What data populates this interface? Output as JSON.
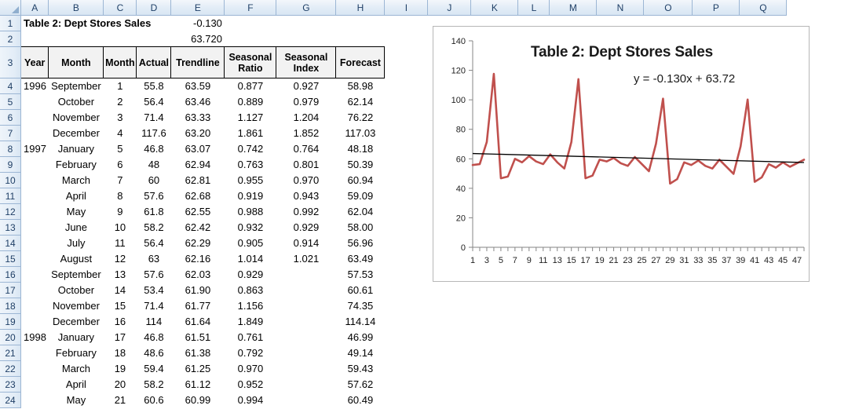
{
  "spreadsheet": {
    "column_headers": [
      "A",
      "B",
      "C",
      "D",
      "E",
      "F",
      "G",
      "H",
      "I",
      "J",
      "K",
      "L",
      "M",
      "N",
      "O",
      "P",
      "Q"
    ],
    "row_numbers": [
      "1",
      "2",
      "3",
      "4",
      "5",
      "6",
      "7",
      "8",
      "9",
      "10",
      "11",
      "12",
      "13",
      "14",
      "15",
      "16",
      "17",
      "18",
      "19",
      "20",
      "21",
      "22",
      "23",
      "24"
    ],
    "title_cell": "Table 2: Dept Stores Sales",
    "slope_cell": "-0.130",
    "intercept_cell": "63.720",
    "table_headers": [
      "Year",
      "Month",
      "Month",
      "Actual",
      "Trendline",
      "Seasonal Ratio",
      "Seasonal Index",
      "Forecast"
    ],
    "table_headers_lines": [
      [
        "Year"
      ],
      [
        "Month"
      ],
      [
        "Month"
      ],
      [
        "Actual"
      ],
      [
        "Trendline"
      ],
      [
        "Seasonal",
        "Ratio"
      ],
      [
        "Seasonal",
        "Index"
      ],
      [
        "Forecast"
      ]
    ],
    "rows": [
      {
        "row": "4",
        "year": "1996",
        "month_name": "September",
        "month_num": "1",
        "actual": "55.8",
        "trendline": "63.59",
        "seasonal_ratio": "0.877",
        "seasonal_index": "0.927",
        "forecast": "58.98"
      },
      {
        "row": "5",
        "year": "",
        "month_name": "October",
        "month_num": "2",
        "actual": "56.4",
        "trendline": "63.46",
        "seasonal_ratio": "0.889",
        "seasonal_index": "0.979",
        "forecast": "62.14"
      },
      {
        "row": "6",
        "year": "",
        "month_name": "November",
        "month_num": "3",
        "actual": "71.4",
        "trendline": "63.33",
        "seasonal_ratio": "1.127",
        "seasonal_index": "1.204",
        "forecast": "76.22"
      },
      {
        "row": "7",
        "year": "",
        "month_name": "December",
        "month_num": "4",
        "actual": "117.6",
        "trendline": "63.20",
        "seasonal_ratio": "1.861",
        "seasonal_index": "1.852",
        "forecast": "117.03"
      },
      {
        "row": "8",
        "year": "1997",
        "month_name": "January",
        "month_num": "5",
        "actual": "46.8",
        "trendline": "63.07",
        "seasonal_ratio": "0.742",
        "seasonal_index": "0.764",
        "forecast": "48.18"
      },
      {
        "row": "9",
        "year": "",
        "month_name": "February",
        "month_num": "6",
        "actual": "48",
        "trendline": "62.94",
        "seasonal_ratio": "0.763",
        "seasonal_index": "0.801",
        "forecast": "50.39"
      },
      {
        "row": "10",
        "year": "",
        "month_name": "March",
        "month_num": "7",
        "actual": "60",
        "trendline": "62.81",
        "seasonal_ratio": "0.955",
        "seasonal_index": "0.970",
        "forecast": "60.94"
      },
      {
        "row": "11",
        "year": "",
        "month_name": "April",
        "month_num": "8",
        "actual": "57.6",
        "trendline": "62.68",
        "seasonal_ratio": "0.919",
        "seasonal_index": "0.943",
        "forecast": "59.09"
      },
      {
        "row": "12",
        "year": "",
        "month_name": "May",
        "month_num": "9",
        "actual": "61.8",
        "trendline": "62.55",
        "seasonal_ratio": "0.988",
        "seasonal_index": "0.992",
        "forecast": "62.04"
      },
      {
        "row": "13",
        "year": "",
        "month_name": "June",
        "month_num": "10",
        "actual": "58.2",
        "trendline": "62.42",
        "seasonal_ratio": "0.932",
        "seasonal_index": "0.929",
        "forecast": "58.00"
      },
      {
        "row": "14",
        "year": "",
        "month_name": "July",
        "month_num": "11",
        "actual": "56.4",
        "trendline": "62.29",
        "seasonal_ratio": "0.905",
        "seasonal_index": "0.914",
        "forecast": "56.96"
      },
      {
        "row": "15",
        "year": "",
        "month_name": "August",
        "month_num": "12",
        "actual": "63",
        "trendline": "62.16",
        "seasonal_ratio": "1.014",
        "seasonal_index": "1.021",
        "forecast": "63.49"
      },
      {
        "row": "16",
        "year": "",
        "month_name": "September",
        "month_num": "13",
        "actual": "57.6",
        "trendline": "62.03",
        "seasonal_ratio": "0.929",
        "seasonal_index": "",
        "forecast": "57.53"
      },
      {
        "row": "17",
        "year": "",
        "month_name": "October",
        "month_num": "14",
        "actual": "53.4",
        "trendline": "61.90",
        "seasonal_ratio": "0.863",
        "seasonal_index": "",
        "forecast": "60.61"
      },
      {
        "row": "18",
        "year": "",
        "month_name": "November",
        "month_num": "15",
        "actual": "71.4",
        "trendline": "61.77",
        "seasonal_ratio": "1.156",
        "seasonal_index": "",
        "forecast": "74.35"
      },
      {
        "row": "19",
        "year": "",
        "month_name": "December",
        "month_num": "16",
        "actual": "114",
        "trendline": "61.64",
        "seasonal_ratio": "1.849",
        "seasonal_index": "",
        "forecast": "114.14"
      },
      {
        "row": "20",
        "year": "1998",
        "month_name": "January",
        "month_num": "17",
        "actual": "46.8",
        "trendline": "61.51",
        "seasonal_ratio": "0.761",
        "seasonal_index": "",
        "forecast": "46.99"
      },
      {
        "row": "21",
        "year": "",
        "month_name": "February",
        "month_num": "18",
        "actual": "48.6",
        "trendline": "61.38",
        "seasonal_ratio": "0.792",
        "seasonal_index": "",
        "forecast": "49.14"
      },
      {
        "row": "22",
        "year": "",
        "month_name": "March",
        "month_num": "19",
        "actual": "59.4",
        "trendline": "61.25",
        "seasonal_ratio": "0.970",
        "seasonal_index": "",
        "forecast": "59.43"
      },
      {
        "row": "23",
        "year": "",
        "month_name": "April",
        "month_num": "20",
        "actual": "58.2",
        "trendline": "61.12",
        "seasonal_ratio": "0.952",
        "seasonal_index": "",
        "forecast": "57.62"
      },
      {
        "row": "24",
        "year": "",
        "month_name": "May",
        "month_num": "21",
        "actual": "60.6",
        "trendline": "60.99",
        "seasonal_ratio": "0.994",
        "seasonal_index": "",
        "forecast": "60.49"
      }
    ]
  },
  "chart_data": {
    "type": "line",
    "title": "Table 2: Dept Stores Sales",
    "annotation": "y = -0.130x + 63.72",
    "xlabel": "",
    "ylabel": "",
    "ylim": [
      0,
      140
    ],
    "ytick_values": [
      0,
      20,
      40,
      60,
      80,
      100,
      120,
      140
    ],
    "xlim": [
      1,
      48
    ],
    "xtick_labels": [
      "1",
      "3",
      "5",
      "7",
      "9",
      "11",
      "13",
      "15",
      "17",
      "19",
      "21",
      "23",
      "25",
      "27",
      "29",
      "31",
      "33",
      "35",
      "37",
      "39",
      "41",
      "43",
      "45",
      "47"
    ],
    "grid": false,
    "legend": false,
    "series_color": "#C0504D",
    "trendline_color": "#000000",
    "series": [
      {
        "name": "Actual",
        "x": [
          1,
          2,
          3,
          4,
          5,
          6,
          7,
          8,
          9,
          10,
          11,
          12,
          13,
          14,
          15,
          16,
          17,
          18,
          19,
          20,
          21,
          22,
          23,
          24,
          25,
          26,
          27,
          28,
          29,
          30,
          31,
          32,
          33,
          34,
          35,
          36,
          37,
          38,
          39,
          40,
          41,
          42,
          43,
          44,
          45,
          46,
          47,
          48
        ],
        "values": [
          55.8,
          56.4,
          71.4,
          117.6,
          46.8,
          48,
          60,
          57.6,
          61.8,
          58.2,
          56.4,
          63,
          57.6,
          53.4,
          71.4,
          114,
          46.8,
          48.6,
          59.4,
          58.2,
          60.6,
          57.0,
          55.2,
          61.2,
          56.4,
          51.6,
          70.2,
          100.8,
          43.2,
          46.2,
          57.6,
          55.8,
          58.8,
          55.2,
          53.4,
          59.4,
          54.6,
          49.8,
          68.4,
          100.2,
          44.4,
          47.4,
          56.4,
          54.0,
          57.6,
          54.6,
          57.0,
          59.4
        ]
      },
      {
        "name": "Trendline",
        "x": [
          1,
          48
        ],
        "values": [
          63.59,
          57.48
        ]
      }
    ]
  }
}
